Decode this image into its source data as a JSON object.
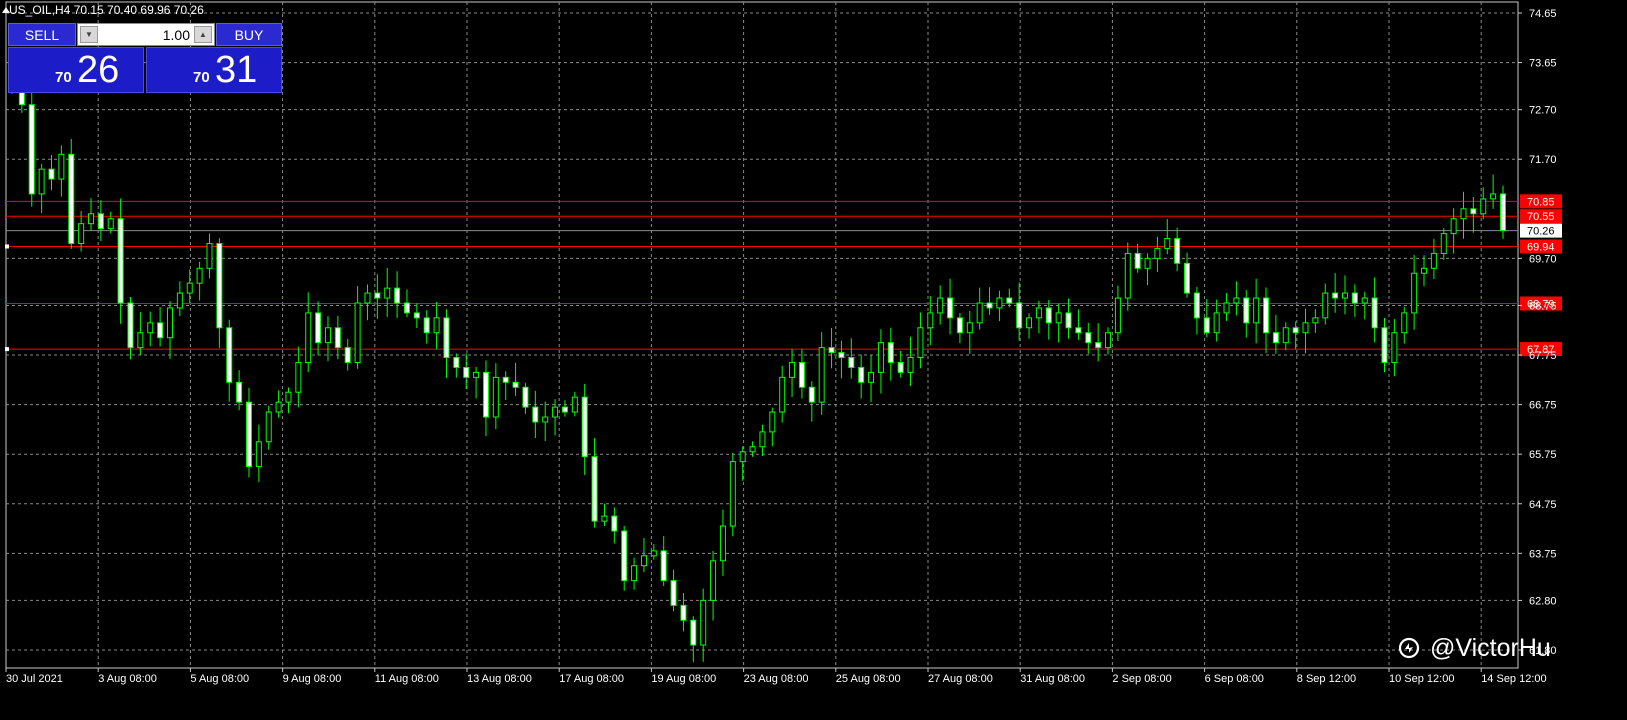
{
  "header": {
    "symbol_info": "US_OIL,H4  70.15 70.40 69.96 70.26"
  },
  "trade_panel": {
    "sell_label": "SELL",
    "buy_label": "BUY",
    "lot_value": "1.00",
    "sell_price_small": "70",
    "sell_price_big": "26",
    "buy_price_small": "70",
    "buy_price_big": "31",
    "color": "#1c1cc8"
  },
  "watermark": {
    "text": "@VictorHu",
    "icon": "circle-logo-icon"
  },
  "chart_data": {
    "type": "candlestick",
    "symbol": "US_OIL",
    "timeframe": "H4",
    "ylim": [
      61.8,
      74.75
    ],
    "y_ticks": [
      74.65,
      73.65,
      72.7,
      71.7,
      69.7,
      68.75,
      67.75,
      66.75,
      65.75,
      64.75,
      63.75,
      62.8,
      61.8
    ],
    "x_tick_labels": [
      "30 Jul 2021",
      "3 Aug 08:00",
      "5 Aug 08:00",
      "9 Aug 08:00",
      "11 Aug 08:00",
      "13 Aug 08:00",
      "17 Aug 08:00",
      "19 Aug 08:00",
      "23 Aug 08:00",
      "25 Aug 08:00",
      "27 Aug 08:00",
      "31 Aug 08:00",
      "2 Sep 08:00",
      "6 Sep 08:00",
      "8 Sep 12:00",
      "10 Sep 12:00",
      "14 Sep 12:00"
    ],
    "current_price": {
      "value": 70.26,
      "label": "70.26"
    },
    "levels": [
      {
        "value": 70.85,
        "label": "70.85",
        "color": "#ff0000"
      },
      {
        "value": 70.55,
        "label": "70.55",
        "color": "#ff0000"
      },
      {
        "value": 69.94,
        "label": "69.94",
        "color": "#ff0000"
      },
      {
        "value": 68.79,
        "label": "68.79",
        "color": "#ff0000"
      },
      {
        "value": 67.87,
        "label": "67.87",
        "color": "#ff0000"
      }
    ],
    "candle_up_color": "#00ff00",
    "candle_down_color": "#ffffff",
    "grid": true,
    "background": "#000000",
    "close_series": [
      73.3,
      72.8,
      71.0,
      71.5,
      71.3,
      71.8,
      70.0,
      70.4,
      70.6,
      70.3,
      70.5,
      68.8,
      67.9,
      68.2,
      68.4,
      68.1,
      68.7,
      69.0,
      69.2,
      69.5,
      70.0,
      68.3,
      67.2,
      66.8,
      65.5,
      66.0,
      66.6,
      66.8,
      67.0,
      67.6,
      68.6,
      68.0,
      68.3,
      67.9,
      67.6,
      68.8,
      69.0,
      68.9,
      69.1,
      68.8,
      68.6,
      68.5,
      68.2,
      68.5,
      67.7,
      67.5,
      67.3,
      67.4,
      66.5,
      67.3,
      67.2,
      67.1,
      66.7,
      66.4,
      66.5,
      66.7,
      66.6,
      66.9,
      65.7,
      64.4,
      64.5,
      64.2,
      63.2,
      63.5,
      63.7,
      63.8,
      63.2,
      62.7,
      62.4,
      61.9,
      62.8,
      63.6,
      64.3,
      65.6,
      65.8,
      65.9,
      66.2,
      66.6,
      67.3,
      67.6,
      67.1,
      66.8,
      67.9,
      67.8,
      67.7,
      67.5,
      67.2,
      67.4,
      68.0,
      67.6,
      67.4,
      67.7,
      68.3,
      68.6,
      68.9,
      68.5,
      68.2,
      68.4,
      68.8,
      68.7,
      68.9,
      68.8,
      68.3,
      68.5,
      68.7,
      68.4,
      68.6,
      68.3,
      68.2,
      68.0,
      67.9,
      68.2,
      68.9,
      69.8,
      69.5,
      69.7,
      69.9,
      70.1,
      69.6,
      69.0,
      68.5,
      68.2,
      68.6,
      68.8,
      68.9,
      68.4,
      68.9,
      68.2,
      68.0,
      68.3,
      68.2,
      68.4,
      68.5,
      69.0,
      68.9,
      69.0,
      68.8,
      68.9,
      68.3,
      67.6,
      68.2,
      68.6,
      69.4,
      69.5,
      69.8,
      70.2,
      70.5,
      70.7,
      70.6,
      70.9,
      71.0,
      70.26
    ]
  }
}
